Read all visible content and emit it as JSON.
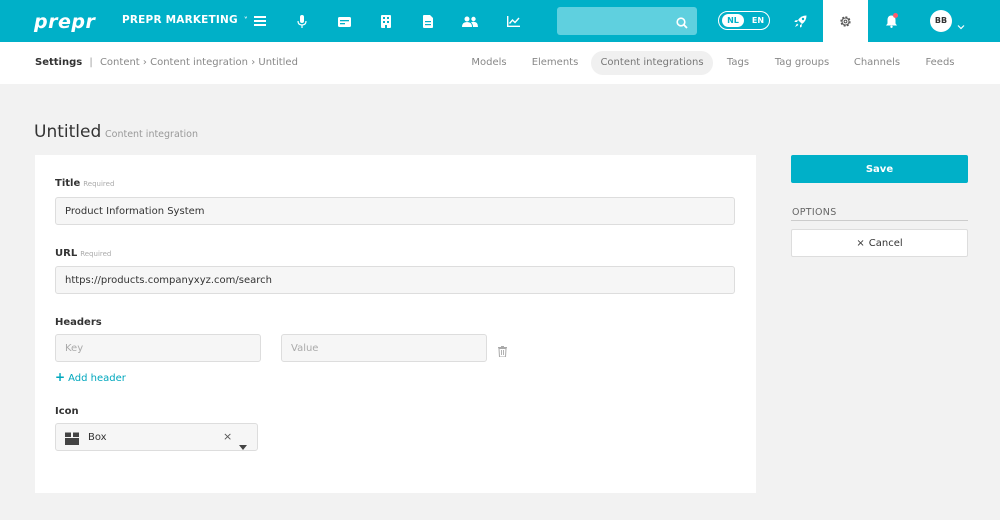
{
  "topbar": {
    "logo": "prepr",
    "workspace": "PREPR MARKETING",
    "workspace_chevron": "˅",
    "nav_icons": [
      "menu-icon",
      "microphone-icon",
      "wallet-icon",
      "building-icon",
      "document-icon",
      "users-icon",
      "chart-icon"
    ],
    "search": {
      "value": "",
      "placeholder": ""
    },
    "languages": [
      "NL",
      "EN"
    ],
    "active_language": "NL",
    "avatar_initials": "BB",
    "accent_color": "#00b0c8"
  },
  "subnav": {
    "breadcrumb": {
      "root": "Settings",
      "divider": "|",
      "items": [
        "Content",
        "Content integration",
        "Untitled"
      ],
      "chevron": "›"
    },
    "tabs": [
      {
        "label": "Models"
      },
      {
        "label": "Elements"
      },
      {
        "label": "Content integrations"
      },
      {
        "label": "Tags"
      },
      {
        "label": "Tag groups"
      },
      {
        "label": "Channels"
      },
      {
        "label": "Feeds"
      }
    ],
    "active_tab": "Content integrations"
  },
  "page": {
    "title": "Untitled",
    "subtitle": "Content integration"
  },
  "form": {
    "title": {
      "label": "Title",
      "required": "Required",
      "value": "Product Information System"
    },
    "url": {
      "label": "URL",
      "required": "Required",
      "value": "https://products.companyxyz.com/search"
    },
    "headers": {
      "label": "Headers",
      "key_placeholder": "Key",
      "value_placeholder": "Value",
      "add_label": "Add header",
      "add_icon": "+"
    },
    "icon": {
      "label": "Icon",
      "value": "Box",
      "clear": "×"
    }
  },
  "sidebar": {
    "save": "Save",
    "options_label": "OPTIONS",
    "cancel": "Cancel",
    "cancel_icon": "×"
  }
}
